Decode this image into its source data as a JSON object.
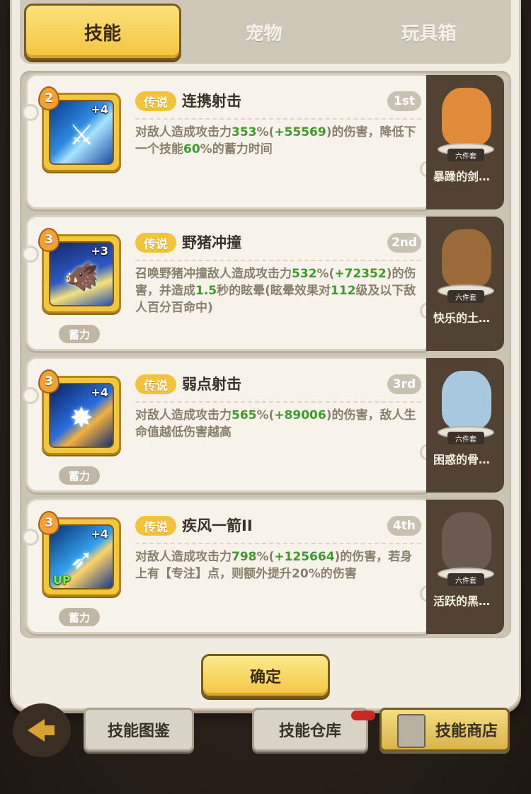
{
  "tabs": [
    {
      "label": "技能",
      "active": true
    },
    {
      "label": "宠物",
      "active": false
    },
    {
      "label": "玩具箱",
      "active": false
    }
  ],
  "skills": [
    {
      "rank": "2",
      "plus": "+4",
      "tier": "传说",
      "name": "连携射击",
      "order": "1st",
      "charge": "",
      "up": "",
      "desc": [
        "对敌人造成攻击力",
        "353",
        "%(",
        "+55569",
        ")的伤害，降低下一个技能",
        "60",
        "%的蓄力时间"
      ]
    },
    {
      "rank": "3",
      "plus": "+3",
      "tier": "传说",
      "name": "野猪冲撞",
      "order": "2nd",
      "charge": "蓄力",
      "up": "",
      "desc": [
        "召唤野猪冲撞敌人造成攻击力",
        "532",
        "%(",
        "+72352",
        ")的伤害，并造成",
        "1.5",
        "秒的眩晕(眩晕效果对",
        "112",
        "级及以下敌人百分百命中)"
      ]
    },
    {
      "rank": "3",
      "plus": "+4",
      "tier": "传说",
      "name": "弱点射击",
      "order": "3rd",
      "charge": "蓄力",
      "up": "",
      "desc": [
        "对敌人造成攻击力",
        "565",
        "%(",
        "+89006",
        ")的伤害，敌人生命值越低伤害越高"
      ]
    },
    {
      "rank": "3",
      "plus": "+4",
      "tier": "传说",
      "name": "疾风一箭II",
      "order": "4th",
      "charge": "蓄力",
      "up": "UP",
      "desc": [
        "对敌人造成攻击力",
        "798",
        "%(",
        "+125664",
        ")的伤害，若身上有【专注】点，则额外提升20%的伤害"
      ]
    }
  ],
  "pets": [
    {
      "set": "六件套",
      "name": "暴躁的剑…",
      "color": "#e08b3a"
    },
    {
      "set": "六件套",
      "name": "快乐的土…",
      "color": "#9a6a3a"
    },
    {
      "set": "六件套",
      "name": "困惑的骨…",
      "color": "#a8c8e0"
    },
    {
      "set": "六件套",
      "name": "活跃的黑…",
      "color": "#6a5a50"
    }
  ],
  "confirm_label": "确定",
  "bottom_buttons": {
    "codex": "技能图鉴",
    "storage": "技能仓库",
    "shop": "技能商店"
  }
}
